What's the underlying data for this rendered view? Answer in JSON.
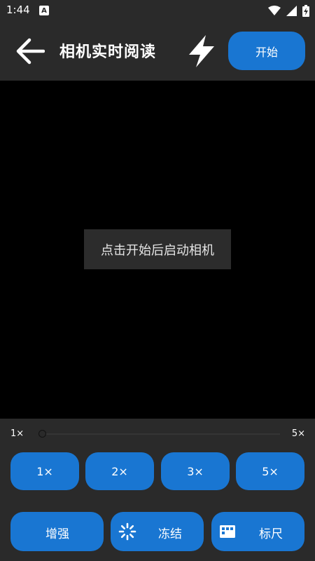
{
  "status_bar": {
    "time": "1:44",
    "notification_letter": "A",
    "icons": [
      "wifi-icon",
      "cell-signal-icon",
      "battery-icon"
    ]
  },
  "header": {
    "title": "相机实时阅读",
    "back_icon": "arrow-left-icon",
    "flash_icon": "flash-icon",
    "start_label": "开始"
  },
  "preview": {
    "hint": "点击开始后启动相机"
  },
  "zoom": {
    "min_label": "1×",
    "max_label": "5×",
    "level": 1,
    "buttons": [
      {
        "label": "1×"
      },
      {
        "label": "2×"
      },
      {
        "label": "3×"
      },
      {
        "label": "5×"
      }
    ]
  },
  "actions": {
    "enhance_label": "增强",
    "freeze_label": "冻结",
    "freeze_icon": "loading-spinner-icon",
    "ruler_label": "标尺",
    "ruler_icon": "grid-ruler-icon"
  },
  "colors": {
    "accent": "#1976d2",
    "background": "#2a2a2a",
    "preview": "#000000"
  }
}
